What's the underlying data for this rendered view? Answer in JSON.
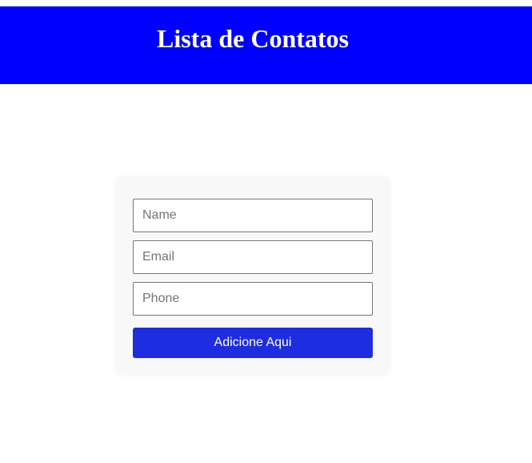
{
  "header": {
    "title": "Lista de Contatos"
  },
  "form": {
    "name_placeholder": "Name",
    "email_placeholder": "Email",
    "phone_placeholder": "Phone",
    "submit_label": "Adicione Aqui"
  },
  "colors": {
    "header_background": "#0000ff",
    "button_background": "#1f2de0",
    "card_background": "#f8f8f8"
  }
}
